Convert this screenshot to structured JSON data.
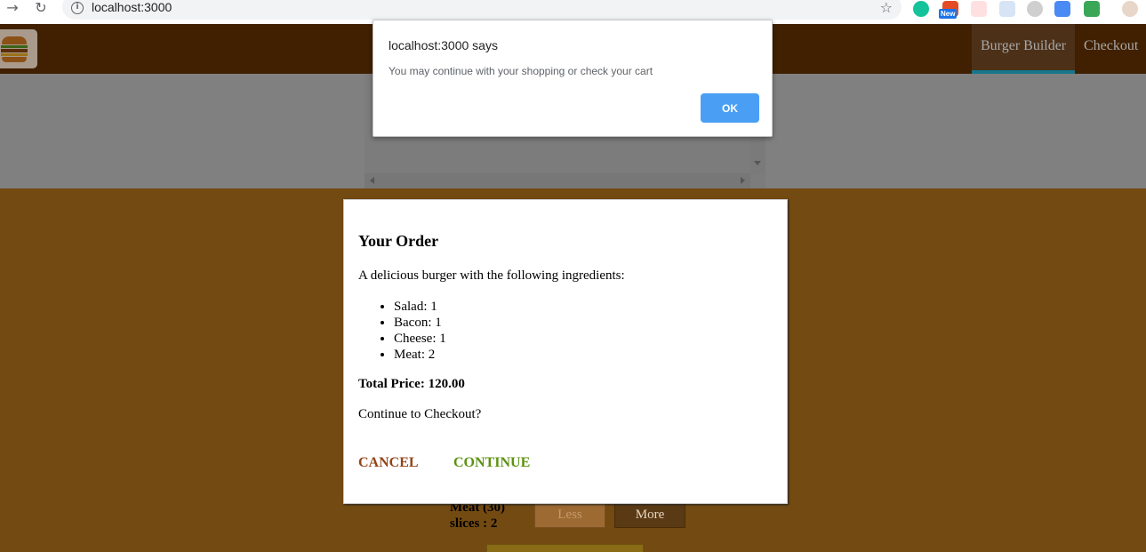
{
  "browser": {
    "url": "localhost:3000",
    "new_badge": "New"
  },
  "toolbar": {
    "nav": [
      {
        "label": "Burger Builder",
        "active": true
      },
      {
        "label": "Checkout",
        "active": false
      }
    ]
  },
  "builder": {
    "control_label": "Meat (30) slices : 2",
    "less_label": "Less",
    "more_label": "More"
  },
  "modal": {
    "title": "Your Order",
    "intro": "A delicious burger with the following ingredients:",
    "ingredients": [
      {
        "text": "Salad: 1"
      },
      {
        "text": "Bacon: 1"
      },
      {
        "text": "Cheese: 1"
      },
      {
        "text": "Meat: 2"
      }
    ],
    "total": "Total Price: 120.00",
    "question": "Continue to Checkout?",
    "cancel_label": "CANCEL",
    "continue_label": "CONTINUE"
  },
  "alert": {
    "title": "localhost:3000 says",
    "message": "You may continue with your shopping or check your cart",
    "ok_label": "OK",
    "ok_color": "#4a9ff5"
  },
  "colors": {
    "page_bg": "#734a12",
    "toolbar_bg": "#402000",
    "cancel": "#944317",
    "continue": "#5c9210"
  },
  "icons": [
    "back-arrow-icon",
    "reload-icon",
    "info-icon",
    "star-icon",
    "grammarly-icon",
    "extension-icon",
    "profile-avatar-icon",
    "burger-logo-icon"
  ]
}
